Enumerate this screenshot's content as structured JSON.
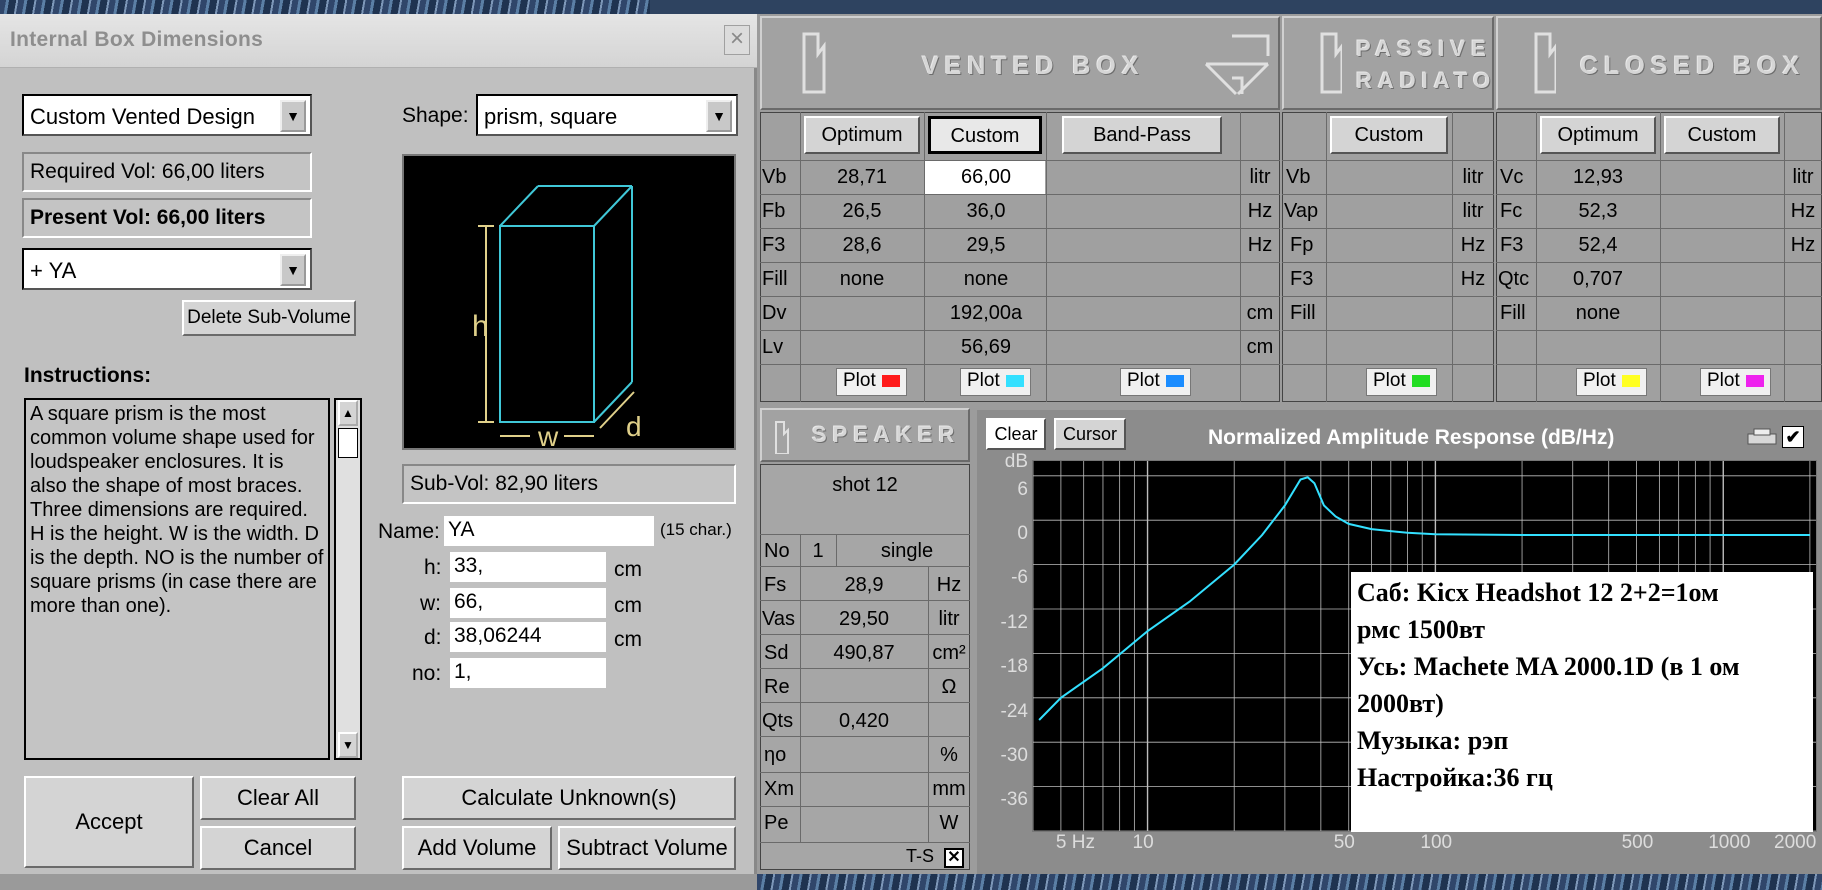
{
  "dialog": {
    "title": "Internal Box Dimensions",
    "close_label": "×",
    "design_select": "Custom Vented Design",
    "required_vol": "Required Vol: 66,00 liters",
    "present_vol": "Present Vol: 66,00 liters",
    "subvol_select": "+ YA",
    "delete_subvol": "Delete Sub-Volume",
    "instructions_label": "Instructions:",
    "instructions_text": "A square prism is the most common volume shape used for loudspeaker enclosures. It is also the shape of most braces. Three dimensions are required. H is the height. W is the width. D is the depth. NO is the number of square prisms (in case there are more than one).",
    "shape_label": "Shape:",
    "shape_select": "prism, square",
    "diagram": {
      "h": "h",
      "w": "w",
      "d": "d"
    },
    "subvol_info": "Sub-Vol: 82,90 liters",
    "name_label": "Name:",
    "name_value": "YA",
    "name_hint": "(15 char.)",
    "h_label": "h:",
    "h_value": "33,",
    "h_unit": "cm",
    "w_label": "w:",
    "w_value": "66,",
    "w_unit": "cm",
    "d_label": "d:",
    "d_value": "38,06244",
    "d_unit": "cm",
    "no_label": "no:",
    "no_value": "1,",
    "accept": "Accept",
    "clear_all": "Clear All",
    "cancel": "Cancel",
    "calc_unknown": "Calculate Unknown(s)",
    "add_volume": "Add Volume",
    "subtract_volume": "Subtract Volume"
  },
  "vented": {
    "title": "VENTED BOX",
    "tabs": [
      "Optimum",
      "Custom",
      "Band-Pass"
    ],
    "rows": [
      {
        "label": "Vb",
        "optimum": "28,71",
        "custom": "66,00",
        "unit": "litr"
      },
      {
        "label": "Fb",
        "optimum": "26,5",
        "custom": "36,0",
        "unit": "Hz"
      },
      {
        "label": "F3",
        "optimum": "28,6",
        "custom": "29,5",
        "unit": "Hz"
      },
      {
        "label": "Fill",
        "optimum": "none",
        "custom": "none",
        "unit": ""
      },
      {
        "label": "Dv",
        "optimum": "",
        "custom": "192,00a",
        "unit": "cm"
      },
      {
        "label": "Lv",
        "optimum": "",
        "custom": "56,69",
        "unit": "cm"
      }
    ],
    "plot": "Plot",
    "plot_colors": [
      "#ff1a1a",
      "#33e0ff",
      "#1a8cff"
    ]
  },
  "passive": {
    "title_line1": "PASSIVE",
    "title_line2": "RADIATOR",
    "tab": "Custom",
    "rows": [
      {
        "label": "Vb",
        "unit": "litr"
      },
      {
        "label": "Vap",
        "unit": "litr"
      },
      {
        "label": "Fp",
        "unit": "Hz"
      },
      {
        "label": "F3",
        "unit": "Hz"
      },
      {
        "label": "Fill",
        "unit": ""
      }
    ],
    "plot": "Plot",
    "plot_color": "#22dd22"
  },
  "closed": {
    "title": "CLOSED BOX",
    "tabs": [
      "Optimum",
      "Custom"
    ],
    "rows": [
      {
        "label": "Vc",
        "optimum": "12,93",
        "unit": "litr"
      },
      {
        "label": "Fc",
        "optimum": "52,3",
        "unit": "Hz"
      },
      {
        "label": "F3",
        "optimum": "52,4",
        "unit": "Hz"
      },
      {
        "label": "Qtc",
        "optimum": "0,707",
        "unit": ""
      },
      {
        "label": "Fill",
        "optimum": "none",
        "unit": ""
      }
    ],
    "plot": "Plot",
    "plot_colors": [
      "#ffff22",
      "#ee22ee"
    ]
  },
  "speaker": {
    "title": "SPEAKER",
    "name": "shot 12",
    "no_label": "No",
    "no_value": "1",
    "mode": "single",
    "rows": [
      {
        "label": "Fs",
        "value": "28,9",
        "unit": "Hz"
      },
      {
        "label": "Vas",
        "value": "29,50",
        "unit": "litr"
      },
      {
        "label": "Sd",
        "value": "490,87",
        "unit": "cm²"
      },
      {
        "label": "Re",
        "value": "",
        "unit": "Ω"
      },
      {
        "label": "Qts",
        "value": "0,420",
        "unit": ""
      },
      {
        "label": "ηo",
        "value": "",
        "unit": "%"
      },
      {
        "label": "Xm",
        "value": "",
        "unit": "mm"
      },
      {
        "label": "Pe",
        "value": "",
        "unit": "W"
      }
    ],
    "ts_label": "T-S",
    "ts_checked": true
  },
  "graph": {
    "clear": "Clear",
    "cursor": "Cursor",
    "title": "Normalized Amplitude Response (dB/Hz)",
    "check": "✔",
    "y_ticks": [
      "dB",
      "6",
      "0",
      "-6",
      "-12",
      "-18",
      "-24",
      "-30",
      "-36"
    ],
    "x_ticks": [
      "5 Hz",
      "10",
      "50",
      "100",
      "500",
      "1000",
      "2000"
    ],
    "note_lines": [
      "Саб: Kicx Headshot 12 2+2=1ом",
      "рмс 1500вт",
      "Усь: Machete MA 2000.1D (в 1 ом",
      "2000вт)",
      "Музыка: рэп",
      "Настройка:36 гц"
    ]
  },
  "chart_data": {
    "type": "line",
    "title": "Normalized Amplitude Response (dB/Hz)",
    "xlabel": "Hz",
    "ylabel": "dB",
    "x_scale": "log",
    "xlim": [
      4,
      2100
    ],
    "ylim": [
      -40,
      10
    ],
    "grid": true,
    "series": [
      {
        "color": "#33e0ff",
        "x": [
          4.2,
          5,
          7,
          10,
          14,
          20,
          25,
          30,
          34,
          36,
          38,
          41,
          45,
          50,
          60,
          80,
          100,
          200,
          500,
          1000,
          2000
        ],
        "y": [
          -25,
          -22,
          -18,
          -13,
          -9,
          -4,
          0,
          4,
          7.5,
          7.8,
          7,
          4,
          2.5,
          1.5,
          0.8,
          0.3,
          0.1,
          0,
          0,
          0,
          0
        ]
      }
    ]
  }
}
